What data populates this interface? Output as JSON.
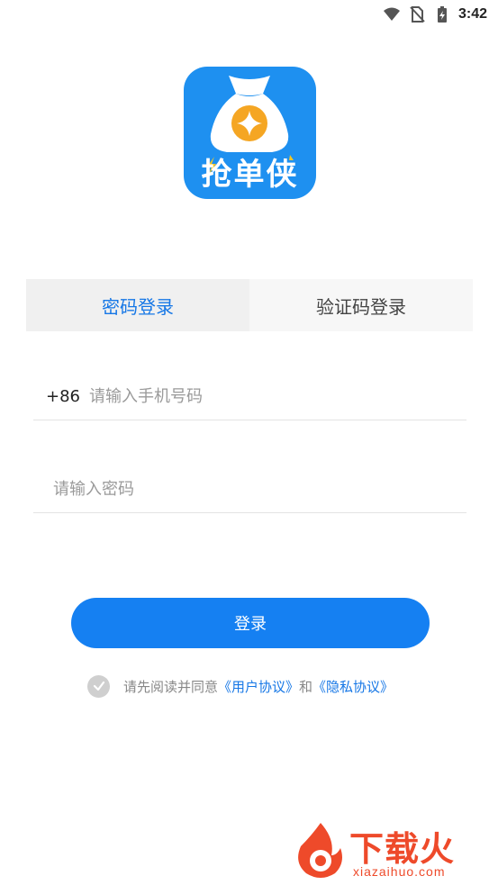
{
  "status_bar": {
    "time": "3:42",
    "icons": [
      "wifi-icon",
      "no-sim-icon",
      "battery-charging-icon"
    ]
  },
  "app": {
    "logo_text": "抢单侠",
    "brand_color": "#1e90f0"
  },
  "tabs": [
    {
      "label": "密码登录",
      "active": true
    },
    {
      "label": "验证码登录",
      "active": false
    }
  ],
  "phone": {
    "country_code": "+86",
    "placeholder": "请输入手机号码",
    "value": ""
  },
  "password": {
    "placeholder": "请输入密码",
    "value": ""
  },
  "login_button": {
    "label": "登录",
    "color": "#1580f2"
  },
  "agreement": {
    "prefix": "请先阅读并同意",
    "user_agreement": "《用户协议》",
    "conjunction": "和",
    "privacy_policy": "《隐私协议》",
    "checked": false
  },
  "watermark": {
    "title": "下载火",
    "subtitle": "xiazaihuo.com",
    "color": "#ee4a2a"
  }
}
